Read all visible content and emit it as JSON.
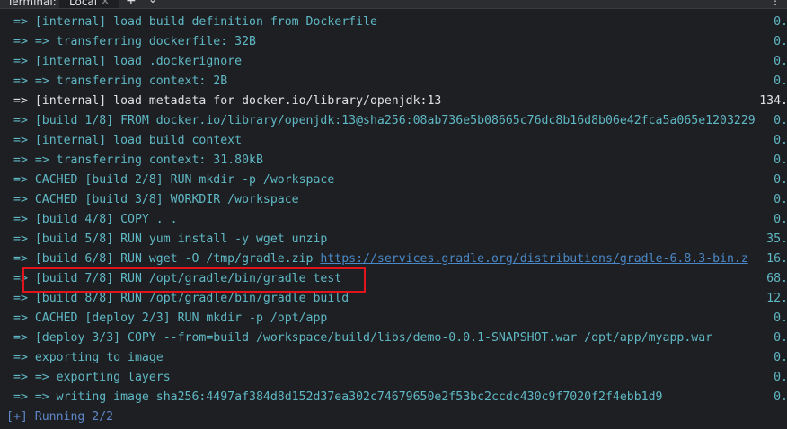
{
  "tabbar": {
    "title": "Terminal:",
    "tab_local": "Local",
    "close_glyph": "×",
    "add_glyph": "+",
    "dropdown_glyph": "⌄",
    "right_glyph": "⋮"
  },
  "lines": [
    {
      "text": "=> [internal] load build definition from Dockerfile",
      "dur": "0."
    },
    {
      "text": "=> => transferring dockerfile: 32B",
      "dur": "0."
    },
    {
      "text": "=> [internal] load .dockerignore",
      "dur": "0."
    },
    {
      "text": "=> => transferring context: 2B",
      "dur": "0."
    },
    {
      "text": "=> [internal] load metadata for docker.io/library/openjdk:13",
      "dur": "134."
    },
    {
      "text": "=> [build 1/8] FROM docker.io/library/openjdk:13@sha256:08ab736e5b08665c76dc8b16d8b06e42fca5a065e1203229",
      "dur": "0."
    },
    {
      "text": "=> [internal] load build context",
      "dur": "0."
    },
    {
      "text": "=> => transferring context: 31.80kB",
      "dur": "0."
    },
    {
      "text": "=> CACHED [build 2/8] RUN mkdir -p /workspace",
      "dur": "0."
    },
    {
      "text": "=> CACHED [build 3/8] WORKDIR /workspace",
      "dur": "0."
    },
    {
      "text": "=> [build 4/8] COPY . .",
      "dur": "0."
    },
    {
      "text": "=> [build 5/8] RUN yum install -y wget unzip",
      "dur": "35."
    },
    {
      "text": "=> [build 6/8] RUN wget -O /tmp/gradle.zip ",
      "url": "https://services.gradle.org/distributions/gradle-6.8.3-bin.z",
      "dur": "16."
    },
    {
      "text": "=> [build 7/8] RUN /opt/gradle/bin/gradle test",
      "dur": "68."
    },
    {
      "text": "=> [build 8/8] RUN /opt/gradle/bin/gradle build",
      "dur": "12."
    },
    {
      "text": "=> CACHED [deploy 2/3] RUN mkdir -p /opt/app",
      "dur": "0."
    },
    {
      "text": "=> [deploy 3/3] COPY --from=build /workspace/build/libs/demo-0.0.1-SNAPSHOT.war /opt/app/myapp.war",
      "dur": "0."
    },
    {
      "text": "=> exporting to image",
      "dur": "0."
    },
    {
      "text": "=> => exporting layers",
      "dur": "0."
    },
    {
      "text": "=> => writing image sha256:4497af384d8d152d37ea302c74679650e2f53bc2ccdc430c9f7020f2f4ebb1d9",
      "dur": "0."
    }
  ],
  "status": "[+] Running 2/2",
  "colors": {
    "background": "#1e1f22",
    "cyan_text": "#5fb8c5",
    "white_text": "#dfe1e5",
    "link": "#4a88c7",
    "highlight_box": "#e2141b"
  }
}
